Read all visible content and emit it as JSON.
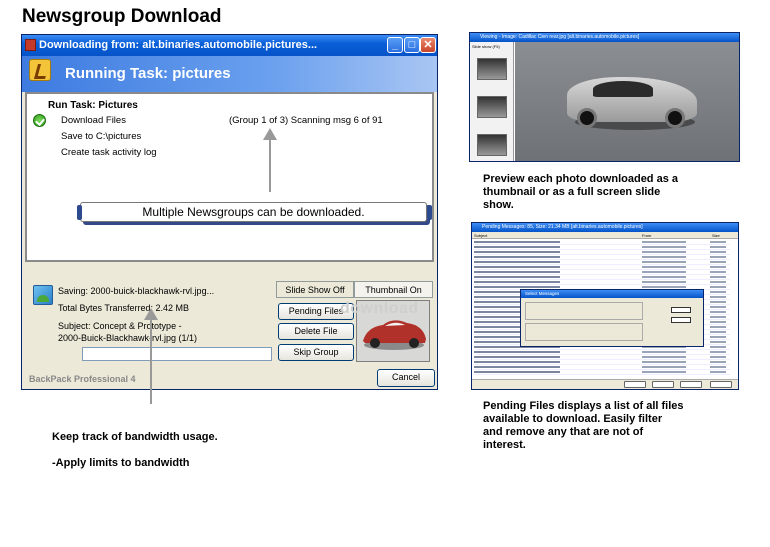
{
  "page_title": "Newsgroup Download",
  "main_window": {
    "title": "Downloading from: alt.binaries.automobile.pictures...",
    "banner": "Running Task: pictures",
    "task_heading": "Run Task: Pictures",
    "steps": [
      "Download Files",
      "Save to C:\\pictures",
      "Create task activity log"
    ],
    "status": "(Group 1 of 3) Scanning msg 6 of 91",
    "callout": "Multiple Newsgroups can be downloaded.",
    "saving": "Saving: 2000-buick-blackhawk-rvl.jpg...",
    "bytes": "Total Bytes Transferred: 2.42 MB",
    "subject_line1": "Subject: Concept & Prototype -",
    "subject_line2": "2000-Buick-Blackhawk-rvl.jpg (1/1)",
    "tab_slideshow": "Slide Show Off",
    "tab_thumbnail": "Thumbnail On",
    "btn_pending": "Pending Files",
    "btn_delete": "Delete File",
    "btn_skip": "Skip Group",
    "btn_cancel": "Cancel",
    "footer": "BackPack Professional 4",
    "watermark": "download"
  },
  "preview_window": {
    "title": "Viewing - Image: Cadillac Cien rear.jpg   [alt.binaries.automobile.pictures]",
    "side_label": "Slide show (F5)"
  },
  "pending_window": {
    "title": "Pending Messages: 85, Size: 21.34 MB   [alt.binaries.automobile.pictures]",
    "col_subject": "Subject",
    "col_from": "From",
    "col_size": "Size",
    "dialog_title": "Select Messages"
  },
  "captions": {
    "preview": [
      "Preview each photo downloaded as a",
      "thumbnail or as a full screen slide",
      "show."
    ],
    "pending": [
      "Pending Files displays a list of all files",
      "available to download.   Easily filter",
      "and remove any that are not of",
      "interest."
    ],
    "bandwidth1": "Keep track of bandwidth usage.",
    "bandwidth2": "-Apply limits to bandwidth"
  }
}
